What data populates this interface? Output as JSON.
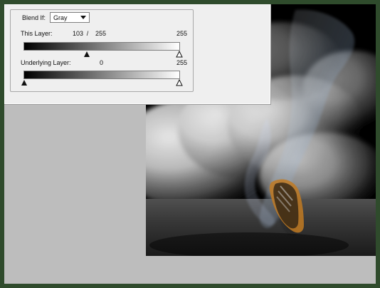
{
  "dialog": {
    "blend_if": {
      "label": "Blend If:",
      "selected": "Gray"
    },
    "this_layer": {
      "label": "This Layer:",
      "value_low": "103",
      "slash": "/",
      "value_mid": "255",
      "value_high": "255",
      "slider_positions": [
        0.403,
        1.0
      ]
    },
    "underlying_layer": {
      "label": "Underlying Layer:",
      "value_low": "0",
      "value_high": "255",
      "slider_positions": [
        0.0,
        1.0
      ]
    }
  },
  "colors": {
    "frame": "#2f4b2c",
    "canvas": "#bdbdbd",
    "dialog_bg": "#efefef"
  }
}
